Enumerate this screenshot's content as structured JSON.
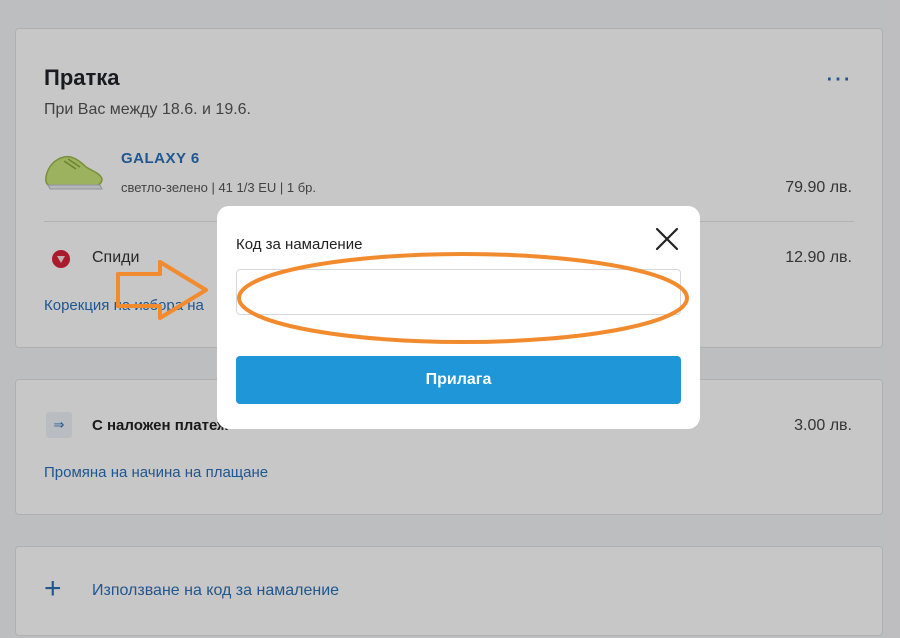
{
  "shipment": {
    "title": "Пратка",
    "delivery_text": "При Вас между 18.6. и 19.6.",
    "more_icon": "ellipsis-icon",
    "product": {
      "name": "GALAXY 6",
      "details": "светло-зелено | 41 1/3 EU | 1 бр.",
      "price": "79.90 лв.",
      "image": "shoe-thumbnail"
    },
    "courier": {
      "name": "Спиди",
      "price": "12.90 лв.",
      "icon": "speedy-logo-icon"
    },
    "edit_link": "Корекция на избора на"
  },
  "payment": {
    "icon": "cash-on-delivery-icon",
    "label": "С наложен платеж",
    "price": "3.00 лв.",
    "change_link": "Промяна на начина на плащане"
  },
  "coupon": {
    "icon": "plus-icon",
    "link": "Използване на код за намаление"
  },
  "modal": {
    "label": "Код за намаление",
    "input_value": "",
    "apply_label": "Прилага",
    "close_icon": "close-icon"
  },
  "colors": {
    "accent": "#1e96d8",
    "link": "#2b6fb6",
    "annotation": "#f28a2e"
  }
}
